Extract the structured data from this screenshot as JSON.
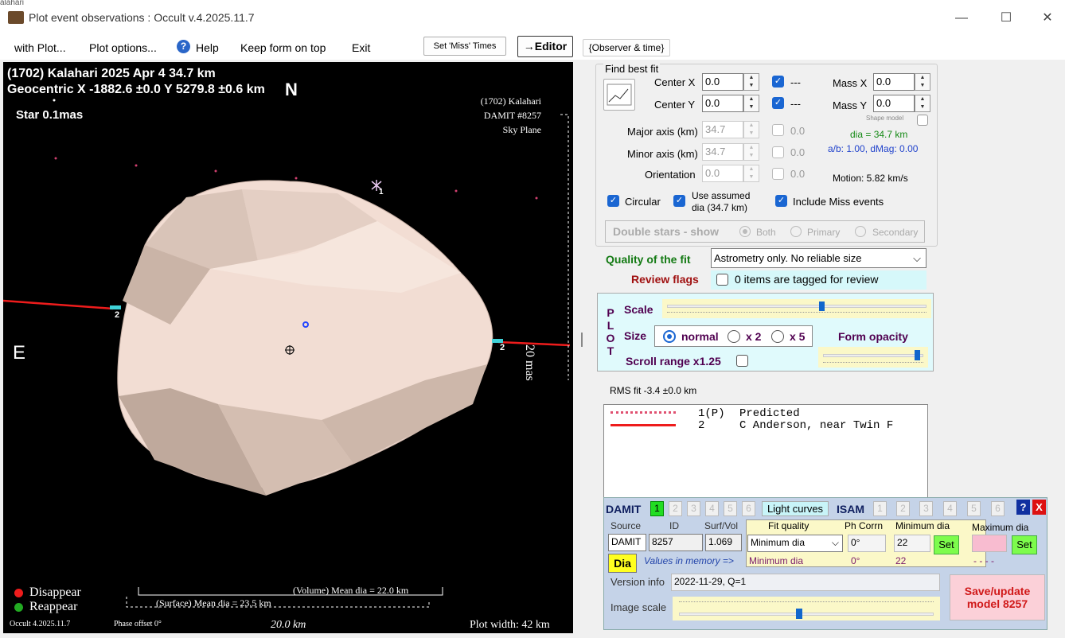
{
  "window": {
    "title": "Plot event observations : Occult v.4.2025.11.7",
    "minimize": "—",
    "maximize": "☐",
    "close": "✕",
    "bg_text": "alahari"
  },
  "menu": {
    "with_plot": "with Plot...",
    "plot_options": "Plot options...",
    "help": "Help",
    "keep_on_top": "Keep form on top",
    "exit": "Exit",
    "set_miss": "Set 'Miss' Times",
    "editor": "→Editor",
    "observer_time": "{Observer & time}"
  },
  "plot": {
    "title1": "(1702) Kalahari  2025 Apr 4   34.7 km",
    "title2": "Geocentric X  -1882.6 ±0.0  Y 5279.8 ±0.6 km",
    "north": "N",
    "east": "E",
    "star": "Star 0.1mas",
    "right1": "(1702) Kalahari",
    "right2": "DAMIT #8257",
    "right3": "Sky Plane",
    "scale_label": "20 mas",
    "chord_label_left": "2",
    "chord_label_right": "2",
    "star_marker": "1",
    "legend_disappear": "Disappear",
    "legend_reappear": "Reappear",
    "volume": "(Volume) Mean dia = 22.0 km",
    "surface": "(Surface) Mean dia = 23.5 km",
    "footer_version": "Occult 4.2025.11.7",
    "footer_phase": "Phase offset 0°",
    "footer_scale": "20.0 km",
    "footer_width": "Plot width: 42 km",
    "colors": {
      "disappear": "#ee1c1c",
      "reappear": "#22aa22",
      "chord": "#ee1c1c",
      "body": "#f2ddd3"
    }
  },
  "fit": {
    "group_label": "Find best fit",
    "center_x_label": "Center X",
    "center_x": "0.0",
    "center_y_label": "Center Y",
    "center_y": "0.0",
    "mass_x_label": "Mass X",
    "mass_x": "0.0",
    "mass_y_label": "Mass Y",
    "mass_y": "0.0",
    "dash": "---",
    "shape_model": "Shape model",
    "major_label": "Major axis (km)",
    "major": "34.7",
    "minor_label": "Minor axis (km)",
    "minor": "34.7",
    "orient_label": "Orientation",
    "orient": "0.0",
    "zero": "0.0",
    "dia": "dia = 34.7 km",
    "ab": "a/b: 1.00, dMag: 0.00",
    "motion": "Motion: 5.82 km/s",
    "circular": "Circular",
    "use_assumed": "Use assumed",
    "use_assumed2": "dia (34.7 km)",
    "include_miss": "Include Miss events",
    "double_stars": "Double stars - show",
    "both": "Both",
    "primary": "Primary",
    "secondary": "Secondary",
    "quality_label": "Quality of the fit",
    "quality_value": "Astrometry only. No reliable size",
    "review_label": "Review flags",
    "review_value": "0 items are tagged for review"
  },
  "plotpanel": {
    "p": "P",
    "l": "L",
    "o": "O",
    "t": "T",
    "scale": "Scale",
    "size": "Size",
    "normal": "normal",
    "x2": "x 2",
    "x5": "x 5",
    "form_opacity": "Form opacity",
    "scroll_range": "Scroll range x1.25",
    "scale_frac": 0.6,
    "opacity_frac": 0.97
  },
  "rms": "RMS fit -3.4 ±0.0 km",
  "list": [
    {
      "num": "1(P)",
      "name": "Predicted"
    },
    {
      "num": "2",
      "name": "C Anderson, near Twin F"
    }
  ],
  "damit": {
    "damit": "DAMIT",
    "isam": "ISAM",
    "light_curves": "Light curves",
    "nums": [
      "1",
      "2",
      "3",
      "4",
      "5",
      "6"
    ],
    "isam_nums": [
      "1",
      "2",
      "3",
      "4",
      "5",
      "6"
    ],
    "help": "?",
    "close": "X",
    "source_h": "Source",
    "id_h": "ID",
    "surf_h": "Surf/Vol",
    "fitq_h": "Fit quality",
    "phcorr_h": "Ph Corrn",
    "mindia_h": "Minimum dia",
    "maxdia_h": "Maximum dia",
    "source": "DAMIT",
    "id": "8257",
    "surf": "1.069",
    "fitq": "Minimum dia",
    "phcorr": "0°",
    "mindia": "22",
    "set": "Set",
    "set2": "Set",
    "dia_btn": "Dia",
    "mem_label": "Values in memory =>",
    "mem_fitq": "Minimum dia",
    "mem_ph": "0°",
    "mem_min": "22",
    "mem_max": "- - - -",
    "version_label": "Version info",
    "version": "2022-11-29, Q=1",
    "image_scale": "Image scale",
    "save1": "Save/update",
    "save2": "model 8257"
  }
}
